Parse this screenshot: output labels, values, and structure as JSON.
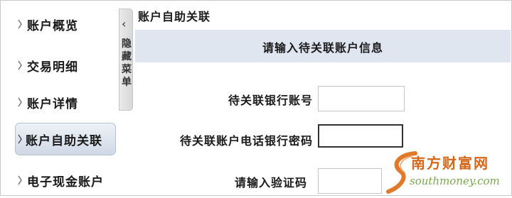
{
  "sidebar": {
    "items": [
      {
        "label": "账户概览",
        "active": false
      },
      {
        "label": "交易明细",
        "active": false
      },
      {
        "label": "账户详情",
        "active": false
      },
      {
        "label": "账户自助关联",
        "active": true
      },
      {
        "label": "电子现金账户",
        "active": false
      }
    ],
    "hide_menu_label": "隐藏菜单"
  },
  "main": {
    "title": "账户自助关联",
    "section_title": "请输入待关联账户信息",
    "fields": [
      {
        "label": "待关联银行账号",
        "value": ""
      },
      {
        "label": "待关联账户电话银行密码",
        "value": ""
      },
      {
        "label": "请输入验证码",
        "value": ""
      }
    ]
  },
  "watermark": {
    "title": "南方财富网",
    "url": "southmoney.com"
  },
  "colors": {
    "section_bar": "#dfe6f0",
    "active_nav": "#cfd9e6",
    "watermark_orange": "#d6671a",
    "watermark_green": "#7aa84f"
  }
}
